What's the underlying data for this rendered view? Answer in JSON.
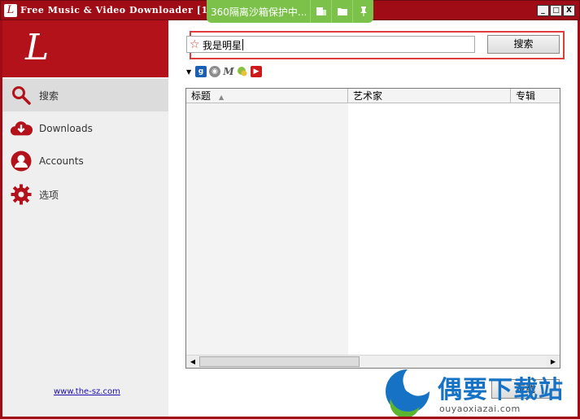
{
  "window": {
    "title": "Free Music & Video Downloader [1.",
    "app_icon_letter": "L",
    "buttons": [
      "_",
      "□",
      "X"
    ]
  },
  "sandbox": {
    "text": "360隔离沙箱保护中...",
    "buttons": [
      "manage-icon",
      "folder-icon",
      "pin-icon"
    ]
  },
  "sidebar": {
    "logo_letter": "L",
    "accent_color": "#b3121b",
    "items": [
      {
        "label": "搜索",
        "icon": "search-icon",
        "active": true
      },
      {
        "label": "Downloads",
        "icon": "download-cloud-icon",
        "active": false
      },
      {
        "label": "Accounts",
        "icon": "user-icon",
        "active": false
      },
      {
        "label": "选项",
        "icon": "gear-icon",
        "active": false
      }
    ],
    "footer_link": "www.the-sz.com"
  },
  "search": {
    "value": "我是明星",
    "button_label": "搜索"
  },
  "sources": [
    "dropdown-caret-icon",
    "grooveshark-icon",
    "cd-icon",
    "myspace-icon",
    "jamendo-icon",
    "youtube-icon"
  ],
  "table": {
    "columns": [
      "标题",
      "艺术家",
      "专辑"
    ],
    "rows": []
  },
  "download_button": "下载",
  "watermark": {
    "title": "偶要下载站",
    "url": "ouyaoxiazai.com"
  }
}
